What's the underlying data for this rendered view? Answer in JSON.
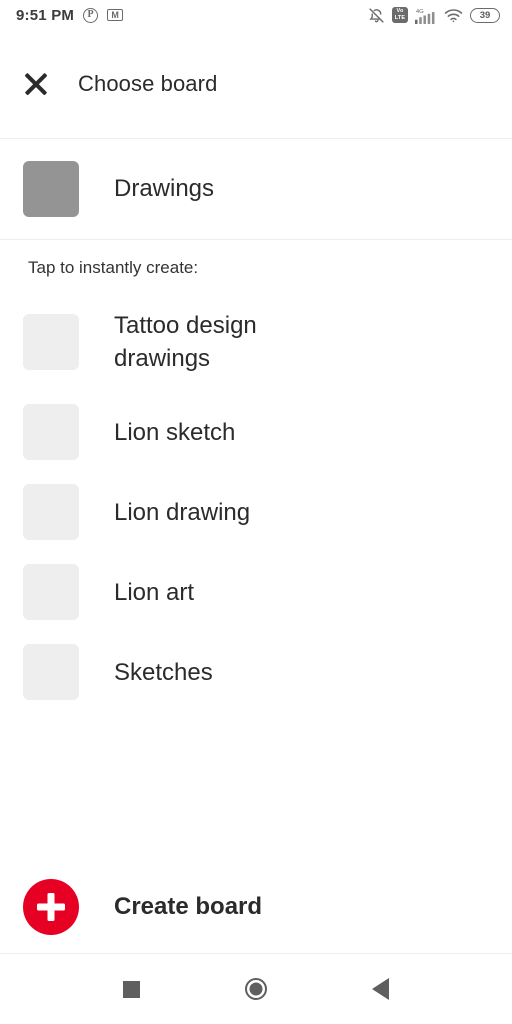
{
  "statusbar": {
    "time": "9:51 PM",
    "pinterest_icon_glyph": "P",
    "gmail_icon_glyph": "M",
    "volte_top": "Vo",
    "volte_bottom": "LTE",
    "signal_label": "4G",
    "battery_level": "39",
    "icons": [
      "pinterest-icon",
      "gmail-icon",
      "bell-off-icon",
      "volte-icon",
      "signal-4g-icon",
      "wifi-icon",
      "battery-icon"
    ]
  },
  "header": {
    "close_icon": "close-icon",
    "title": "Choose board"
  },
  "board": {
    "name": "Drawings",
    "thumbnail_color": "#949494"
  },
  "suggestions": {
    "caption": "Tap to instantly create:",
    "thumbnail_color": "#eeeeee",
    "items": [
      {
        "label": "Tattoo design drawings"
      },
      {
        "label": "Lion sketch"
      },
      {
        "label": "Lion drawing"
      },
      {
        "label": "Lion art"
      },
      {
        "label": "Sketches"
      }
    ]
  },
  "create": {
    "label": "Create board",
    "accent_color": "#e60023",
    "icon": "plus-icon"
  },
  "navbar": {
    "recents": "recents-square-icon",
    "home": "home-circle-icon",
    "back": "back-triangle-icon"
  }
}
